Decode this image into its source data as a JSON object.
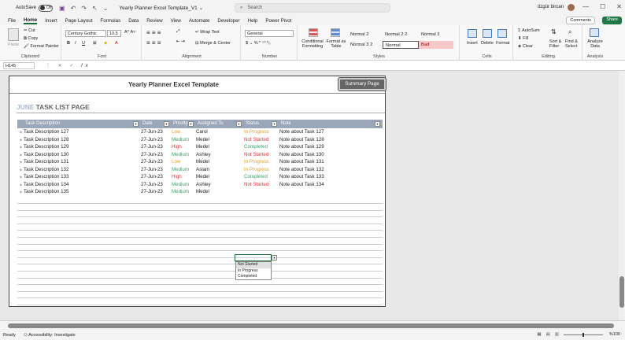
{
  "titlebar": {
    "autosave_label": "AutoSave",
    "autosave_state": "Off",
    "doc_title": "Yearly Planner Excel Template_V1 ⌄",
    "search_placeholder": "Search",
    "user_name": "özgür bircan"
  },
  "menu": {
    "tabs": [
      "File",
      "Home",
      "Insert",
      "Page Layout",
      "Formulas",
      "Data",
      "Review",
      "View",
      "Automate",
      "Developer",
      "Help",
      "Power Pivot"
    ],
    "active": "Home",
    "comments_label": "Comments",
    "share_label": "Share"
  },
  "ribbon": {
    "clipboard": {
      "paste": "Paste",
      "cut": "Cut",
      "copy": "Copy",
      "format_painter": "Format Painter",
      "label": "Clipboard"
    },
    "font": {
      "name": "Century Gothic",
      "size": "10,5",
      "label": "Font"
    },
    "alignment": {
      "wrap": "Wrap Text",
      "merge": "Merge & Center",
      "label": "Alignment"
    },
    "number": {
      "format": "General",
      "label": "Number"
    },
    "styles": {
      "conditional": "Conditional Formatting",
      "format_table": "Format as Table",
      "cells": [
        "Normal 2",
        "Normal 2 2",
        "Normal 3",
        "Normal 3 2",
        "Normal",
        "Bad"
      ],
      "label": "Styles"
    },
    "cells": {
      "insert": "Insert",
      "delete": "Delete",
      "format": "Format",
      "label": "Cells"
    },
    "editing": {
      "autosum": "AutoSum",
      "fill": "Fill",
      "clear": "Clear",
      "sort": "Sort & Filter",
      "find": "Find & Select",
      "label": "Editing"
    },
    "analysis": {
      "analyze": "Analyze Data",
      "label": "Analysis"
    }
  },
  "formula_bar": {
    "name_box": "H145",
    "fx": "fx"
  },
  "sheet": {
    "title": "Yearly Planner Excel Template",
    "summary_button": "Summary Page",
    "month": "JUNE",
    "page_heading": " TASK LIST PAGE",
    "columns": [
      "Task Description",
      "Date",
      "Priority",
      "Assigned To",
      "Status",
      "Note"
    ],
    "rows": [
      [
        "Task Description 127",
        "27-Jun-23",
        "Low",
        "Carol",
        "In Progress",
        "Note about Task 127"
      ],
      [
        "Task Description 128",
        "27-Jun-23",
        "Medium",
        "Medel",
        "Not Started",
        "Note about Task 128"
      ],
      [
        "Task Description 129",
        "27-Jun-23",
        "High",
        "Medel",
        "Completed",
        "Note about Task 129"
      ],
      [
        "Task Description 130",
        "27-Jun-23",
        "Medium",
        "Ashley",
        "Not Started",
        "Note about Task 130"
      ],
      [
        "Task Description 131",
        "27-Jun-23",
        "Low",
        "Medel",
        "In Progress",
        "Note about Task 131"
      ],
      [
        "Task Description 132",
        "27-Jun-23",
        "Medium",
        "Aslam",
        "In Progress",
        "Note about Task 132"
      ],
      [
        "Task Description 133",
        "27-Jun-23",
        "High",
        "Medel",
        "Completed",
        "Note about Task 133"
      ],
      [
        "Task Description 134",
        "27-Jun-23",
        "Medium",
        "Ashley",
        "Not Started",
        "Note about Task 134"
      ],
      [
        "Task Description 135",
        "27-Jun-23",
        "Medium",
        "Medel",
        "",
        ""
      ]
    ],
    "dropdown_options": [
      "Not Started",
      "In Progress",
      "Completed"
    ],
    "colors": {
      "Low": "#e0a030",
      "Medium": "#3aa36a",
      "High": "#e03a3a",
      "In Progress": "#e0a030",
      "Not Started": "#e03a3a",
      "Completed": "#3aa36a"
    }
  },
  "statusbar": {
    "ready": "Ready",
    "accessibility": "Accessibility: Investigate",
    "zoom": "%100"
  }
}
